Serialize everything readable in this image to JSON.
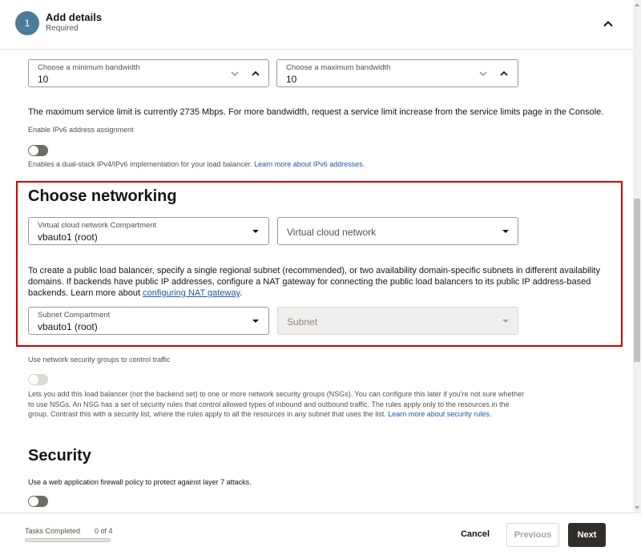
{
  "header": {
    "step_number": "1",
    "title": "Add details",
    "subtitle": "Required"
  },
  "bandwidth": {
    "min": {
      "label": "Choose a minimum bandwidth",
      "value": "10"
    },
    "max": {
      "label": "Choose a maximum bandwidth",
      "value": "10"
    },
    "limit_text": "The maximum service limit is currently 2735 Mbps. For more bandwidth, request a service limit increase from the service limits page in the Console."
  },
  "ipv6": {
    "label": "Enable IPv6 address assignment",
    "toggle_on": false,
    "help_text": "Enables a dual-stack IPv4/IPv6 implementation for your load balancer.",
    "help_link": "Learn more about IPv6 addresses."
  },
  "networking": {
    "heading": "Choose networking",
    "vcn_compartment": {
      "label": "Virtual cloud network Compartment",
      "value": "vbauto1 (root)"
    },
    "vcn": {
      "placeholder": "Virtual cloud network"
    },
    "info_text": "To create a public load balancer, specify a single regional subnet (recommended), or two availability domain-specific subnets in different availability domains. If backends have public IP addresses, configure a NAT gateway for connecting the public load balancers to its public IP address-based backends. Learn more about",
    "info_link": "configuring NAT gateway",
    "info_end": ".",
    "subnet_compartment": {
      "label": "Subnet Compartment",
      "value": "vbauto1 (root)"
    },
    "subnet": {
      "placeholder": "Subnet"
    }
  },
  "nsg": {
    "label": "Use network security groups to control traffic",
    "toggle_on": false,
    "help_text": "Lets you add this load balancer (not the backend set) to one or more network security groups (NSGs). You can configure this later if you're not sure whether to use NSGs. An NSG has a set of security rules that control allowed types of inbound and outbound traffic. The rules apply only to the resources in the group. Contrast this with a security list, where the rules apply to all the resources in any subnet that uses the list.",
    "help_link": "Learn more about security rules."
  },
  "security": {
    "heading": "Security",
    "waf_label": "Use a web application firewall policy to protect against layer 7 attacks.",
    "toggle_on": false
  },
  "footer": {
    "tasks_label": "Tasks Completed",
    "tasks_count": "0 of 4",
    "progress": 0,
    "cancel": "Cancel",
    "previous": "Previous",
    "next": "Next"
  },
  "colors": {
    "accent": "#4c7c97",
    "highlight": "#d50000",
    "primary_button": "#312d2a",
    "link": "#1c5aa0"
  },
  "icons": [
    "chevron-down-icon",
    "chevron-up-icon",
    "caret-down-icon"
  ]
}
